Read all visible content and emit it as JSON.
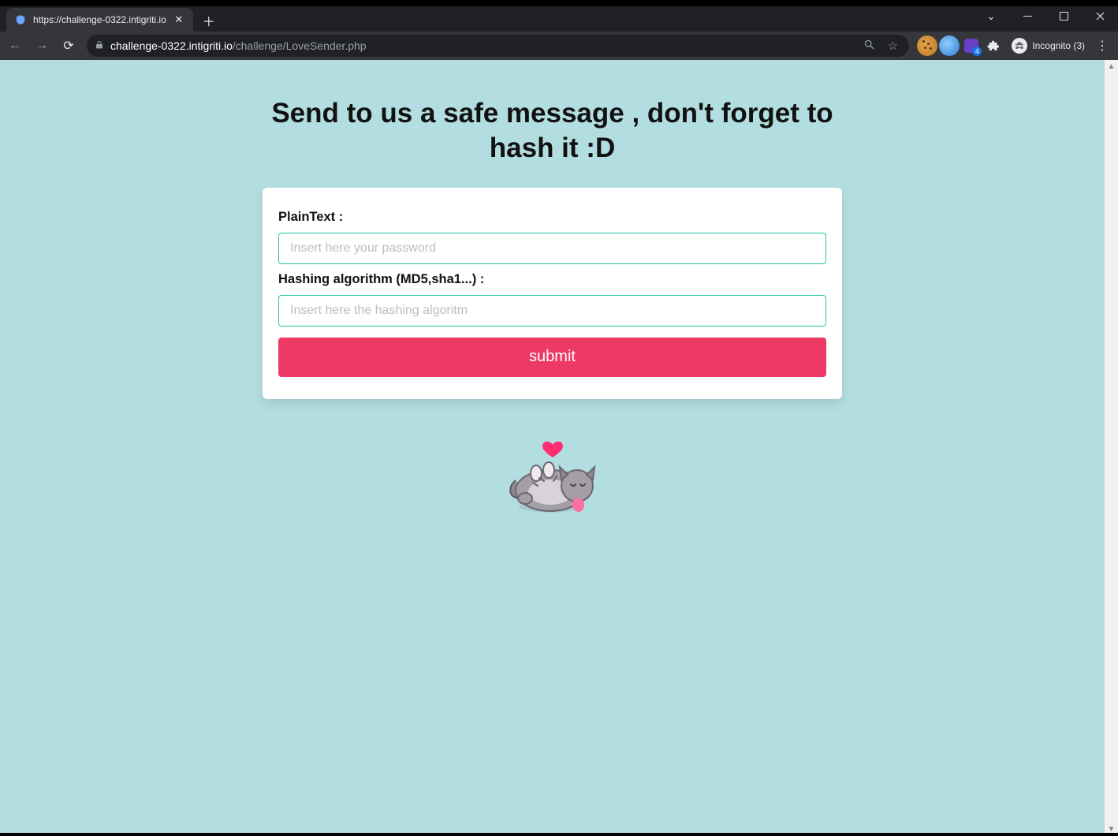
{
  "browser": {
    "tab": {
      "title": "https://challenge-0322.intigriti.io"
    },
    "url": {
      "host": "challenge-0322.intigriti.io",
      "path": "/challenge/LoveSender.php"
    },
    "incognito_label": "Incognito (3)",
    "ext_badge": "4"
  },
  "page": {
    "headline": "Send to us a safe message , don't forget to hash it :D",
    "form": {
      "plaintext_label": "PlainText :",
      "plaintext_placeholder": "Insert here your password",
      "algo_label": "Hashing algorithm (MD5,sha1...) :",
      "algo_placeholder": "Insert here the hashing algoritm",
      "submit_label": "submit"
    }
  }
}
